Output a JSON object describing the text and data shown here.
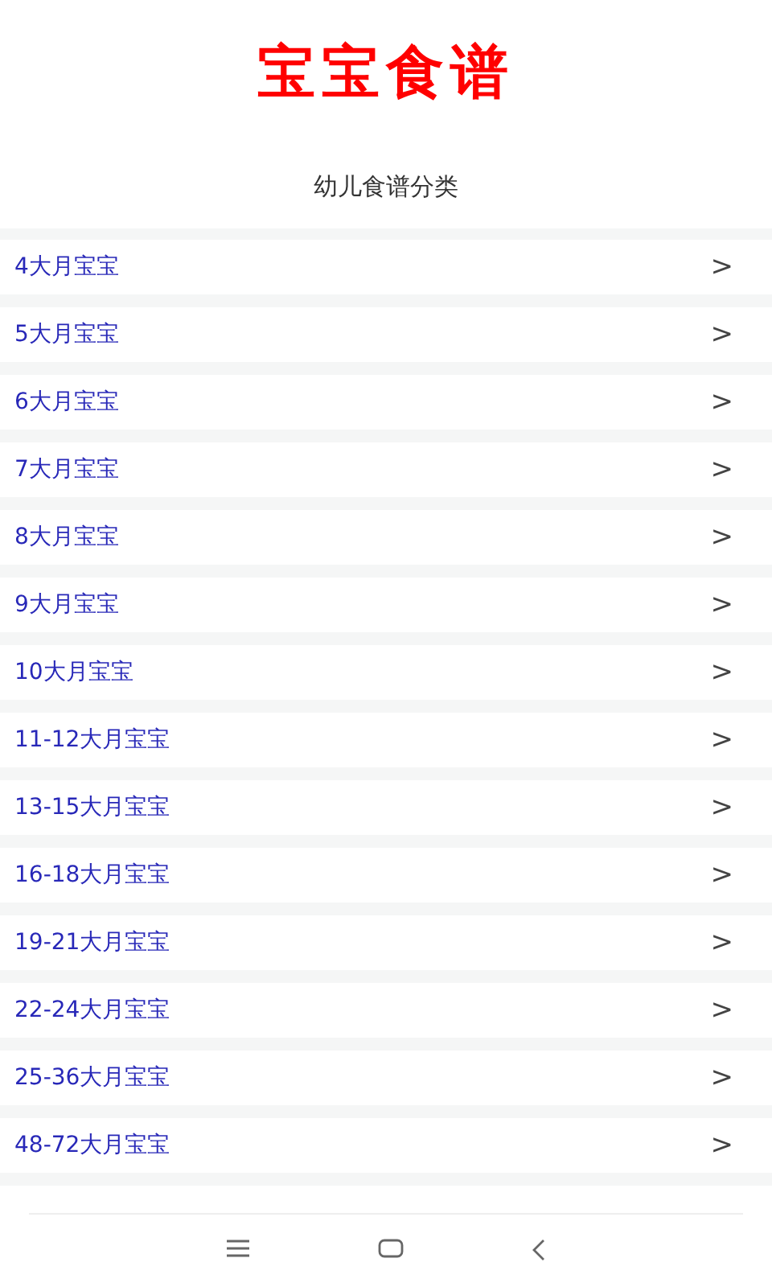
{
  "app_title": "宝宝食谱",
  "subtitle": "幼儿食谱分类",
  "categories": [
    {
      "label": "4大月宝宝",
      "chevron": ">"
    },
    {
      "label": "5大月宝宝",
      "chevron": ">"
    },
    {
      "label": "6大月宝宝",
      "chevron": ">"
    },
    {
      "label": "7大月宝宝",
      "chevron": ">"
    },
    {
      "label": "8大月宝宝",
      "chevron": ">"
    },
    {
      "label": "9大月宝宝",
      "chevron": ">"
    },
    {
      "label": "10大月宝宝",
      "chevron": ">"
    },
    {
      "label": "11-12大月宝宝",
      "chevron": ">"
    },
    {
      "label": "13-15大月宝宝",
      "chevron": ">"
    },
    {
      "label": "16-18大月宝宝",
      "chevron": ">"
    },
    {
      "label": "19-21大月宝宝",
      "chevron": ">"
    },
    {
      "label": "22-24大月宝宝",
      "chevron": ">"
    },
    {
      "label": "25-36大月宝宝",
      "chevron": ">"
    },
    {
      "label": "48-72大月宝宝",
      "chevron": ">"
    }
  ]
}
